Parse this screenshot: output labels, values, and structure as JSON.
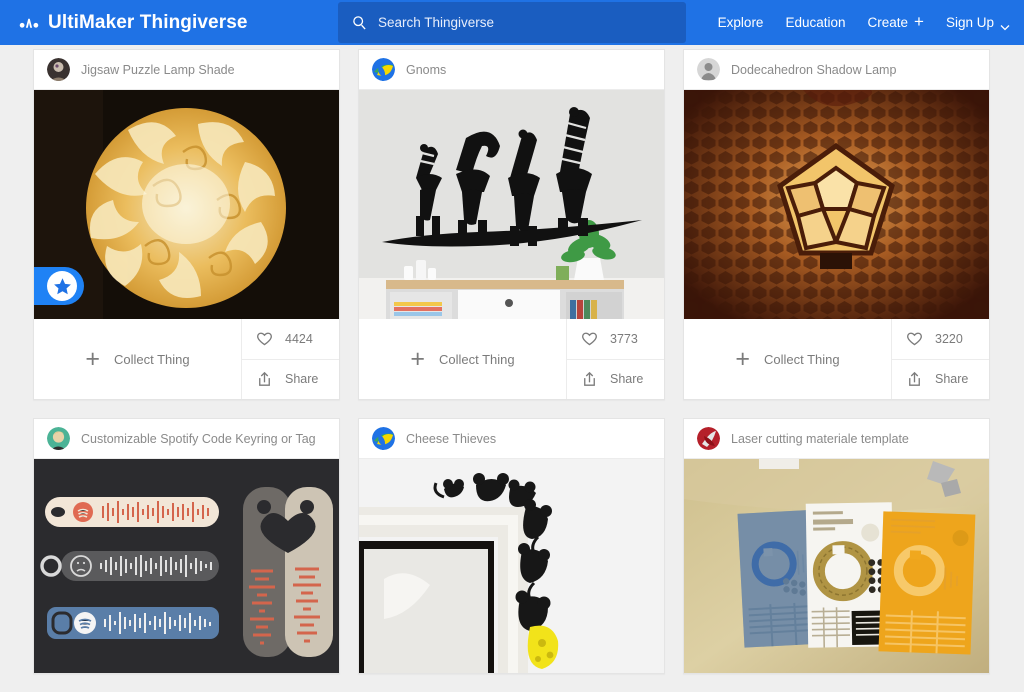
{
  "header": {
    "logo_text": "UltiMaker Thingiverse",
    "logo_icon": "ultimaker-logo-icon",
    "search": {
      "placeholder": "Search Thingiverse",
      "value": "",
      "icon": "search-icon"
    },
    "nav": [
      {
        "label": "Explore",
        "icon": ""
      },
      {
        "label": "Education",
        "icon": ""
      },
      {
        "label": "Create",
        "icon": "plus-icon"
      },
      {
        "label": "Sign Up",
        "icon": "chevron-down-icon"
      }
    ],
    "background_color": "#1f72e5",
    "search_background_color": "#1a5dc0"
  },
  "actions": {
    "collect_label": "Collect Thing",
    "collect_icon": "plus-icon",
    "like_icon": "heart-icon",
    "share_label": "Share",
    "share_icon": "share-icon"
  },
  "cards": [
    {
      "title": "Jigsaw Puzzle Lamp Shade",
      "avatar_type": "photo",
      "avatar_colors": [
        "#6b5a4a",
        "#c9bcae",
        "#3a3230"
      ],
      "likes": "4424",
      "badge": "featured-star-badge",
      "thumb": "jigsaw-puzzle-lamp-shade-photo"
    },
    {
      "title": "Gnoms",
      "avatar_type": "brand",
      "avatar_colors": [
        "#1f72e5",
        "#f5d800",
        "#37a95a"
      ],
      "likes": "3773",
      "badge": "",
      "thumb": "gnome-wall-art-photo"
    },
    {
      "title": "Dodecahedron Shadow Lamp",
      "avatar_type": "default",
      "avatar_colors": [
        "#d6d6d6",
        "#8c8c8c"
      ],
      "likes": "3220",
      "badge": "",
      "thumb": "dodecahedron-shadow-lamp-photo"
    },
    {
      "title": "Customizable Spotify Code Keyring or Tag",
      "avatar_type": "photo",
      "avatar_colors": [
        "#4bb396",
        "#e8d3a8",
        "#2d2d2d"
      ],
      "likes": "",
      "badge": "",
      "thumb": "spotify-code-keyring-photo"
    },
    {
      "title": "Cheese Thieves",
      "avatar_type": "brand",
      "avatar_colors": [
        "#1f72e5",
        "#f5d800",
        "#37a95a"
      ],
      "likes": "",
      "badge": "",
      "thumb": "cheese-thieves-door-frame-photo"
    },
    {
      "title": "Laser cutting materiale template",
      "avatar_type": "photo",
      "avatar_colors": [
        "#b5202a",
        "#8e1018",
        "#e0e0e0"
      ],
      "likes": "",
      "badge": "",
      "thumb": "laser-cutting-material-template-photo"
    }
  ]
}
